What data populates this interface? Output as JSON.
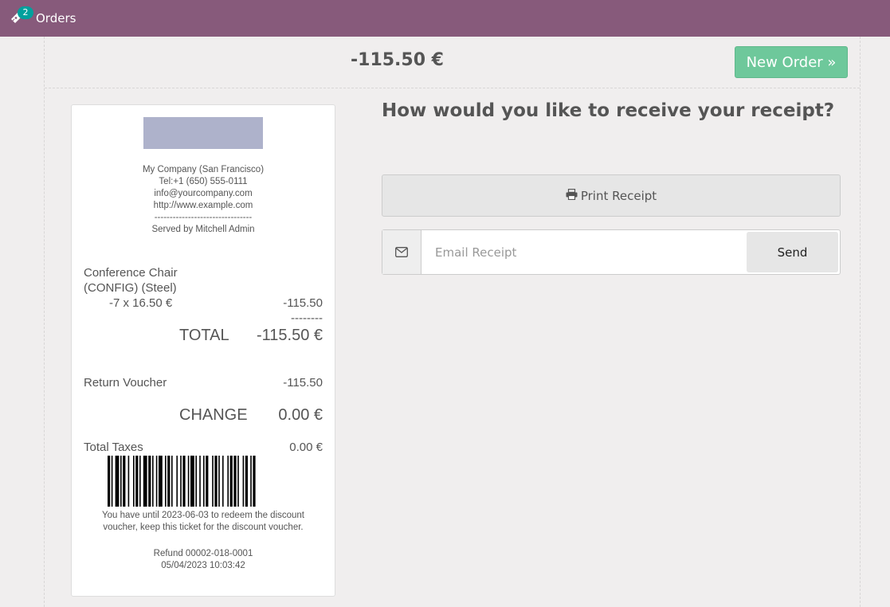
{
  "topbar": {
    "orders_badge": "2",
    "orders_label": "Orders"
  },
  "header": {
    "total": "-115.50 €",
    "new_order_label": "New Order »"
  },
  "receipt": {
    "company": {
      "name": "My Company (San Francisco)",
      "tel": "Tel:+1 (650) 555-0111",
      "email": "info@yourcompany.com",
      "website": "http://www.example.com",
      "separator": "--------------------------------",
      "served_by": "Served by Mitchell Admin"
    },
    "line": {
      "product_line1": "Conference Chair",
      "product_line2": "(CONFIG) (Steel)",
      "qty_price": "-7 x 16.50 €",
      "amount": "-115.50",
      "dashes": "--------"
    },
    "total_label": "TOTAL",
    "total_value": "-115.50 €",
    "payment": {
      "method": "Return Voucher",
      "amount": "-115.50"
    },
    "change_label": "CHANGE",
    "change_value": "0.00 €",
    "taxes_label": "Total Taxes",
    "taxes_value": "0.00 €",
    "voucher_note": "You have until 2023-06-03 to redeem the discount voucher, keep this ticket for the discount voucher.",
    "refund_ref": "Refund 00002-018-0001",
    "datetime": "05/04/2023 10:03:42"
  },
  "main": {
    "question": "How would you like to receive your receipt?",
    "print_label": "Print Receipt",
    "email_placeholder": "Email Receipt",
    "send_label": "Send"
  },
  "icons": {
    "orders": "ticket-icon",
    "print": "printer-icon",
    "email": "envelope-icon"
  },
  "colors": {
    "topbar": "#875a7b",
    "badge": "#01a09d",
    "new_order": "#6ec89b",
    "logo": "#aeb2cb"
  }
}
